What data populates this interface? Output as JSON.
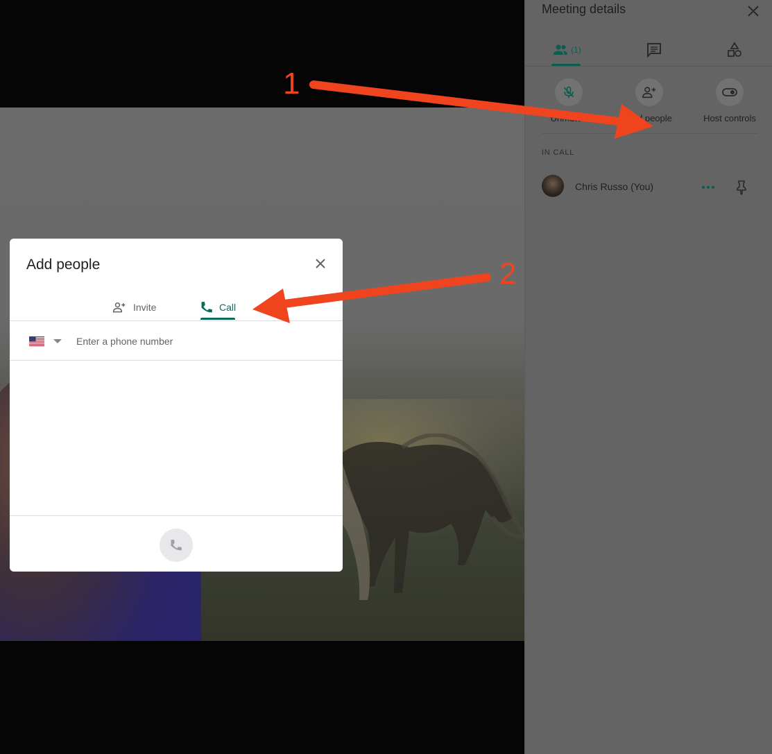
{
  "panel": {
    "title": "Meeting details",
    "tabs": {
      "people_count": "(1)"
    },
    "actions": [
      {
        "label": "Unmuted"
      },
      {
        "label": "Add people"
      },
      {
        "label": "Host controls"
      }
    ],
    "section_label": "IN CALL",
    "participants": [
      {
        "name": "Chris Russo (You)"
      }
    ]
  },
  "dialog": {
    "title": "Add people",
    "tabs": [
      {
        "label": "Invite"
      },
      {
        "label": "Call"
      }
    ],
    "phone_placeholder": "Enter a phone number",
    "country": "United States"
  },
  "annotations": [
    {
      "number": "1"
    },
    {
      "number": "2"
    }
  ],
  "colors": {
    "accent": "#0b6b5e",
    "annotation": "#f0441f"
  }
}
